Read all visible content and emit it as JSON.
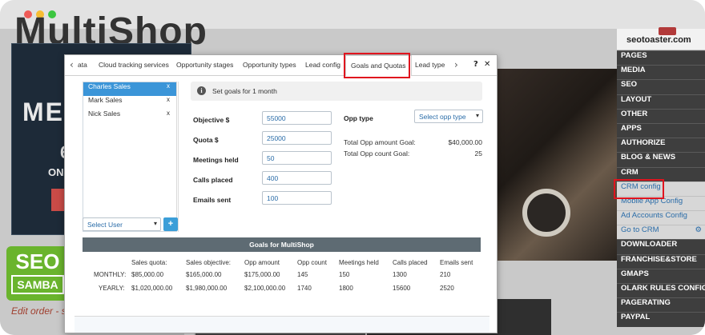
{
  "site": {
    "title_fragment": "MultiShop",
    "hero_big": "ME",
    "hero_num": "6",
    "hero_on": "ON",
    "edit_order": "Edit order - sal",
    "logo_line1": "SEO",
    "logo_line2": "SAMBA"
  },
  "brand": {
    "name": "seotoaster.com"
  },
  "admin_menu": [
    {
      "label": "PAGES",
      "type": "section"
    },
    {
      "label": "MEDIA",
      "type": "section"
    },
    {
      "label": "SEO",
      "type": "section"
    },
    {
      "label": "LAYOUT",
      "type": "section"
    },
    {
      "label": "OTHER",
      "type": "section"
    },
    {
      "label": "APPS",
      "type": "section"
    },
    {
      "label": "AUTHORIZE",
      "type": "section"
    },
    {
      "label": "BLOG & NEWS",
      "type": "section"
    },
    {
      "label": "CRM",
      "type": "section"
    },
    {
      "label": "CRM config",
      "type": "sub"
    },
    {
      "label": "Mobile App Config",
      "type": "sub"
    },
    {
      "label": "Ad Accounts Config",
      "type": "sub"
    },
    {
      "label": "Go to CRM",
      "type": "sub",
      "icon": "gear-icon"
    },
    {
      "label": "DOWNLOADER",
      "type": "section"
    },
    {
      "label": "FRANCHISE&STORE",
      "type": "section"
    },
    {
      "label": "GMAPS",
      "type": "section"
    },
    {
      "label": "OLARK RULES CONFIG",
      "type": "section"
    },
    {
      "label": "PAGERATING",
      "type": "section"
    },
    {
      "label": "PAYPAL",
      "type": "section"
    }
  ],
  "modal": {
    "tabs": {
      "prev_arrow": "‹",
      "partial": "ata",
      "cloud": "Cloud tracking services",
      "stages": "Opportunity stages",
      "types": "Opportunity types",
      "lead_config": "Lead config",
      "goals": "Goals and Quotas",
      "lead_type": "Lead type",
      "next_arrow": "›",
      "help": "?",
      "close": "✕"
    },
    "users": [
      {
        "name": "Charles Sales",
        "remove": "x",
        "selected": true
      },
      {
        "name": "Mark Sales",
        "remove": "x",
        "selected": false
      },
      {
        "name": "Nick Sales",
        "remove": "x",
        "selected": false
      }
    ],
    "select_user": "Select User",
    "add_button": "+",
    "info_icon_glyph": "i",
    "goals_message": "Set goals for 1 month",
    "fields": [
      {
        "label": "Objective $",
        "value": "55000"
      },
      {
        "label": "Quota $",
        "value": "25000"
      },
      {
        "label": "Meetings held",
        "value": "50"
      },
      {
        "label": "Calls placed",
        "value": "400"
      },
      {
        "label": "Emails sent",
        "value": "100"
      }
    ],
    "opp_type_label": "Opp type",
    "opp_type_select": "Select opp type",
    "totals": [
      {
        "label": "Total Opp amount Goal:",
        "value": "$40,000.00"
      },
      {
        "label": "Total Opp count Goal:",
        "value": "25"
      }
    ],
    "summary": {
      "title": "Goals for MultiShop",
      "columns": [
        "Sales quota:",
        "Sales objective:",
        "Opp amount",
        "Opp count",
        "Meetings held",
        "Calls placed",
        "Emails sent"
      ],
      "rows": [
        {
          "label": "MONTHLY:",
          "values": [
            "$85,000.00",
            "$165,000.00",
            "$175,000.00",
            "145",
            "150",
            "1300",
            "210"
          ]
        },
        {
          "label": "YEARLY:",
          "values": [
            "$1,020,000.00",
            "$1,980,000.00",
            "$2,100,000.00",
            "1740",
            "1800",
            "15600",
            "2520"
          ]
        }
      ]
    }
  },
  "colors": {
    "accent_blue": "#3b95d8",
    "highlight_red": "#e0141e",
    "admin_dark": "#3e3e3e",
    "logo_green": "#6ab42d"
  }
}
